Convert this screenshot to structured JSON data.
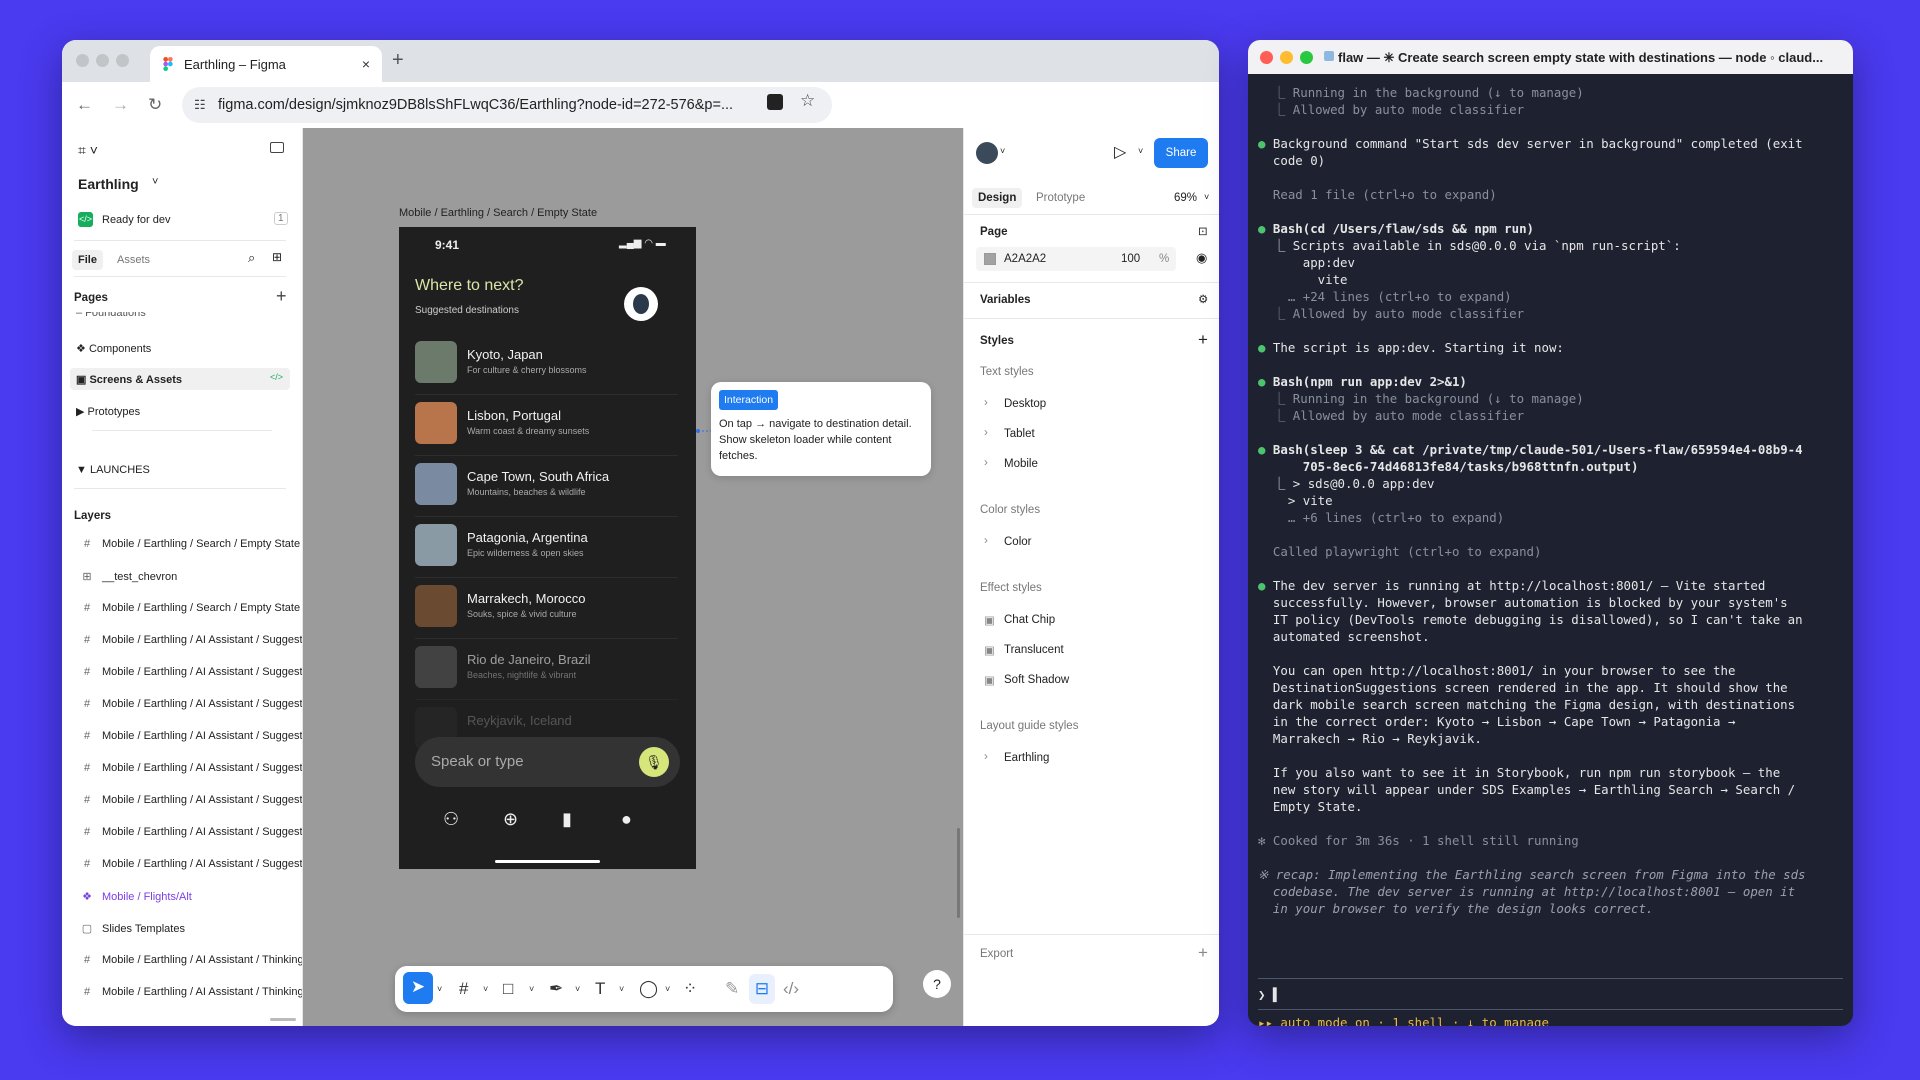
{
  "browser": {
    "tab_title": "Earthling – Figma",
    "new_tab": "+",
    "close": "×",
    "url": "figma.com/design/sjmknoz9DB8lsShFLwqC36/Earthling?node-id=272-576&p=..."
  },
  "left_panel": {
    "file_name": "Earthling",
    "status": "Ready for dev",
    "status_count": "1",
    "tabs": [
      "File",
      "Assets"
    ],
    "pages_title": "Pages",
    "pages_cut": "– Foundations",
    "pages": [
      {
        "icon": "❖",
        "label": "Components"
      },
      {
        "icon": "▣",
        "label": "Screens & Assets"
      },
      {
        "icon": "▶",
        "label": "Prototypes"
      }
    ],
    "section": "LAUNCHES",
    "layers_title": "Layers",
    "layers": [
      {
        "icon": "#",
        "label": "Mobile / Earthling / Search / Empty State"
      },
      {
        "icon": "⊞",
        "label": "__test_chevron"
      },
      {
        "icon": "#",
        "label": "Mobile / Earthling / Search / Empty State"
      },
      {
        "icon": "#",
        "label": "Mobile / Earthling / AI Assistant / Suggestions"
      },
      {
        "icon": "#",
        "label": "Mobile / Earthling / AI Assistant / Suggestions"
      },
      {
        "icon": "#",
        "label": "Mobile / Earthling / AI Assistant / Suggestions"
      },
      {
        "icon": "#",
        "label": "Mobile / Earthling / AI Assistant / Suggestions"
      },
      {
        "icon": "#",
        "label": "Mobile / Earthling / AI Assistant / Suggestions"
      },
      {
        "icon": "#",
        "label": "Mobile / Earthling / AI Assistant / Suggestions"
      },
      {
        "icon": "#",
        "label": "Mobile / Earthling / AI Assistant / Suggestions"
      },
      {
        "icon": "#",
        "label": "Mobile / Earthling / AI Assistant / Suggestions"
      },
      {
        "icon": "❖",
        "label": "Mobile / Flights/Alt"
      },
      {
        "icon": "▢",
        "label": "Slides Templates"
      },
      {
        "icon": "#",
        "label": "Mobile / Earthling / AI Assistant / Thinking"
      },
      {
        "icon": "#",
        "label": "Mobile / Earthling / AI Assistant / Thinking"
      }
    ]
  },
  "canvas": {
    "frame_label": "Mobile / Earthling / Search / Empty State",
    "phone": {
      "time": "9:41",
      "title": "Where to next?",
      "subtitle": "Suggested destinations",
      "destinations": [
        {
          "name": "Kyoto, Japan",
          "desc": "For culture & cherry blossoms",
          "color": "#6b7a6a"
        },
        {
          "name": "Lisbon, Portugal",
          "desc": "Warm coast & dreamy sunsets",
          "color": "#b8744a"
        },
        {
          "name": "Cape Town, South Africa",
          "desc": "Mountains, beaches & wildlife",
          "color": "#7a8aa0"
        },
        {
          "name": "Patagonia, Argentina",
          "desc": "Epic wilderness & open skies",
          "color": "#8a9aa4"
        },
        {
          "name": "Marrakech, Morocco",
          "desc": "Souks, spice & vivid culture",
          "color": "#6a4a30"
        },
        {
          "name": "Rio de Janeiro, Brazil",
          "desc": "Beaches, nightlife & vibrant",
          "color": "#5a5a5a"
        },
        {
          "name": "Reykjavik, Iceland",
          "desc": "",
          "color": "#3a3a3a"
        }
      ],
      "speak_placeholder": "Speak or type"
    },
    "note": {
      "badge": "Interaction",
      "text": "On tap → navigate to destination detail. Show skeleton loader while content fetches."
    },
    "help": "?"
  },
  "right_panel": {
    "share": "Share",
    "tabs": [
      "Design",
      "Prototype"
    ],
    "zoom": "69%",
    "page_title": "Page",
    "page_color": "A2A2A2",
    "page_opacity": "100",
    "percent": "%",
    "variables": "Variables",
    "styles": "Styles",
    "text_styles_title": "Text styles",
    "text_styles": [
      "Desktop",
      "Tablet",
      "Mobile"
    ],
    "color_styles_title": "Color styles",
    "color_styles": [
      "Color"
    ],
    "effect_styles_title": "Effect styles",
    "effect_styles": [
      "Chat Chip",
      "Translucent",
      "Soft Shadow"
    ],
    "layout_styles_title": "Layout guide styles",
    "layout_styles": [
      "Earthling"
    ],
    "export": "Export"
  },
  "terminal": {
    "title": "flaw — ✳ Create search screen empty state with destinations — node ◦ claud...",
    "lines": [
      {
        "t": "  ⎿ Running in the background (↓ to manage)",
        "c": "dim"
      },
      {
        "t": "  ⎿ Allowed by auto mode classifier",
        "c": "dim"
      },
      {
        "t": "",
        "c": ""
      },
      {
        "t": "● Background command \"Start sds dev server in background\" completed (exit",
        "c": ""
      },
      {
        "t": "  code 0)",
        "c": ""
      },
      {
        "t": "",
        "c": ""
      },
      {
        "t": "  Read 1 file (ctrl+o to expand)",
        "c": "dim"
      },
      {
        "t": "",
        "c": ""
      },
      {
        "t": "● Bash(cd /Users/flaw/sds && npm run)",
        "c": "bold"
      },
      {
        "t": "  ⎿ Scripts available in sds@0.0.0 via `npm run-script`:",
        "c": ""
      },
      {
        "t": "      app:dev",
        "c": ""
      },
      {
        "t": "        vite",
        "c": ""
      },
      {
        "t": "    … +24 lines (ctrl+o to expand)",
        "c": "dim"
      },
      {
        "t": "  ⎿ Allowed by auto mode classifier",
        "c": "dim"
      },
      {
        "t": "",
        "c": ""
      },
      {
        "t": "● The script is app:dev. Starting it now:",
        "c": ""
      },
      {
        "t": "",
        "c": ""
      },
      {
        "t": "● Bash(npm run app:dev 2>&1)",
        "c": "bold"
      },
      {
        "t": "  ⎿ Running in the background (↓ to manage)",
        "c": "dim"
      },
      {
        "t": "  ⎿ Allowed by auto mode classifier",
        "c": "dim"
      },
      {
        "t": "",
        "c": ""
      },
      {
        "t": "● Bash(sleep 3 && cat /private/tmp/claude-501/-Users-flaw/659594e4-08b9-4",
        "c": "bold"
      },
      {
        "t": "      705-8ec6-74d46813fe84/tasks/b968ttnfn.output)",
        "c": "bold"
      },
      {
        "t": "  ⎿ > sds@0.0.0 app:dev",
        "c": ""
      },
      {
        "t": "    > vite",
        "c": ""
      },
      {
        "t": "    … +6 lines (ctrl+o to expand)",
        "c": "dim"
      },
      {
        "t": "",
        "c": ""
      },
      {
        "t": "  Called playwright (ctrl+o to expand)",
        "c": "dim"
      },
      {
        "t": "",
        "c": ""
      },
      {
        "t": "● The dev server is running at http://localhost:8001/ — Vite started",
        "c": ""
      },
      {
        "t": "  successfully. However, browser automation is blocked by your system's",
        "c": ""
      },
      {
        "t": "  IT policy (DevTools remote debugging is disallowed), so I can't take an",
        "c": ""
      },
      {
        "t": "  automated screenshot.",
        "c": ""
      },
      {
        "t": "",
        "c": ""
      },
      {
        "t": "  You can open http://localhost:8001/ in your browser to see the",
        "c": ""
      },
      {
        "t": "  DestinationSuggestions screen rendered in the app. It should show the",
        "c": ""
      },
      {
        "t": "  dark mobile search screen matching the Figma design, with destinations",
        "c": ""
      },
      {
        "t": "  in the correct order: Kyoto → Lisbon → Cape Town → Patagonia →",
        "c": ""
      },
      {
        "t": "  Marrakech → Rio → Reykjavik.",
        "c": ""
      },
      {
        "t": "",
        "c": ""
      },
      {
        "t": "  If you also want to see it in Storybook, run npm run storybook — the",
        "c": ""
      },
      {
        "t": "  new story will appear under SDS Examples → Earthling Search → Search /",
        "c": ""
      },
      {
        "t": "  Empty State.",
        "c": ""
      },
      {
        "t": "",
        "c": ""
      },
      {
        "t": "✻ Cooked for 3m 36s · 1 shell still running",
        "c": "dim"
      },
      {
        "t": "",
        "c": ""
      },
      {
        "t": "※ recap: Implementing the Earthling search screen from Figma into the sds",
        "c": "it"
      },
      {
        "t": "  codebase. The dev server is running at http://localhost:8001 — open it",
        "c": "it"
      },
      {
        "t": "  in your browser to verify the design looks correct.",
        "c": "it"
      }
    ],
    "prompt": "❯ ▌",
    "status": "▸▸ auto mode on · 1 shell · ↓ to manage"
  }
}
